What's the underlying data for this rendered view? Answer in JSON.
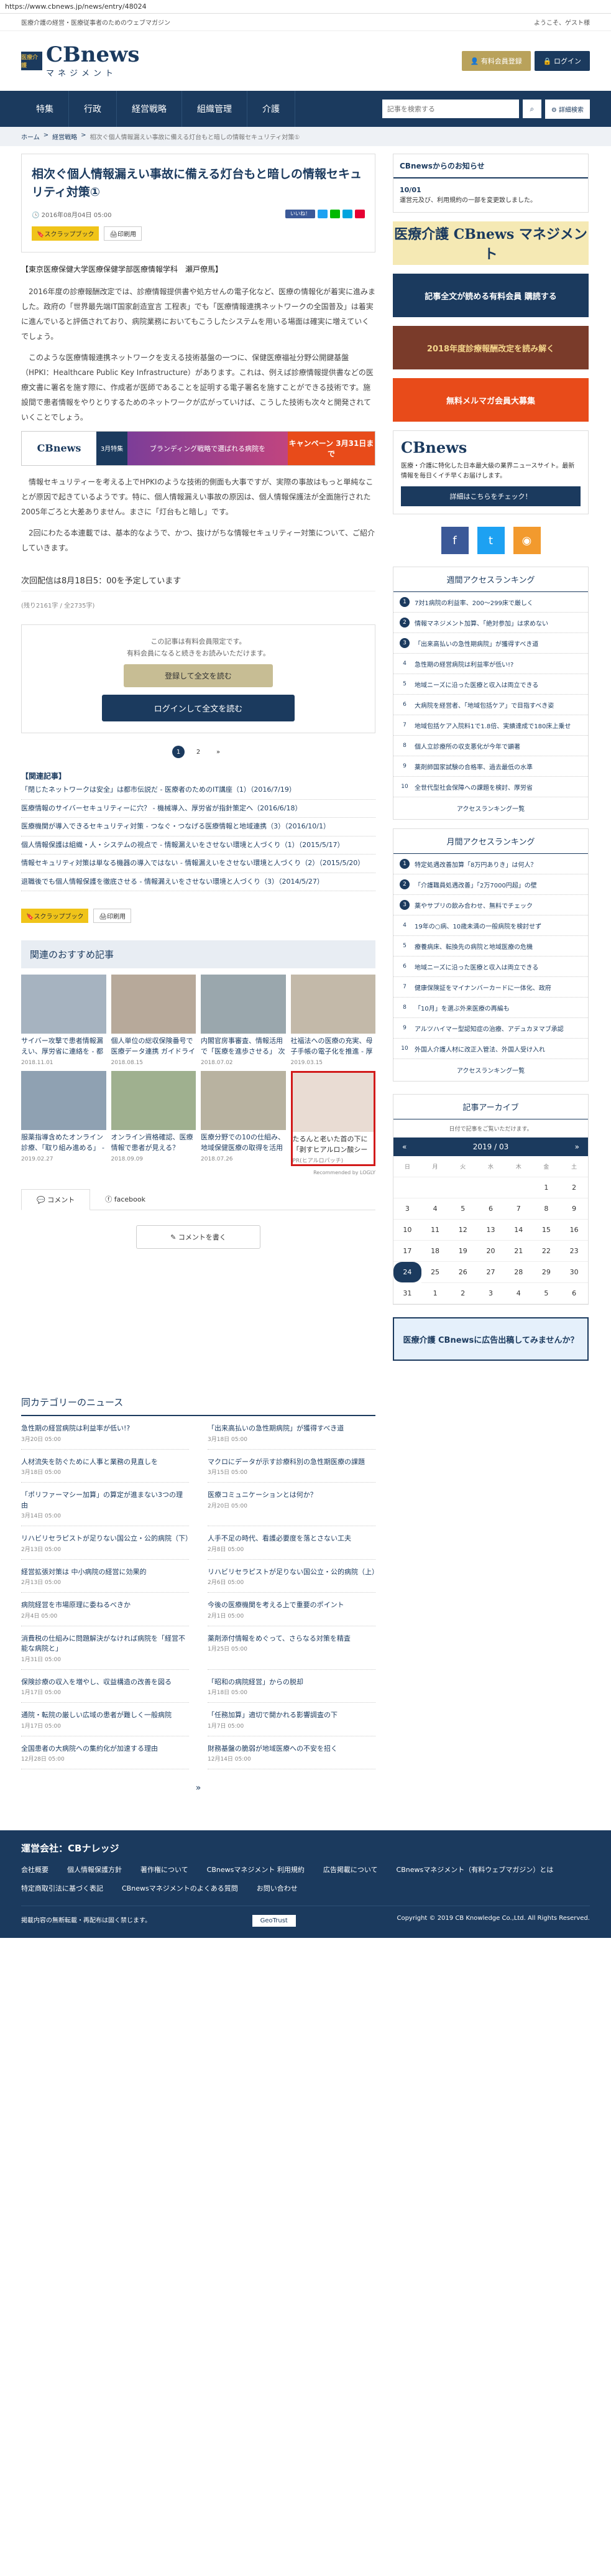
{
  "url": "https://www.cbnews.jp/news/entry/48024",
  "topbar": {
    "tagline": "医療介護の経営・医療従事者のためのウェブマガジン",
    "welcome": "ようこそ、ゲスト様"
  },
  "header": {
    "logo_mark": "医療介護",
    "logo": "CBnews",
    "logo_sub": "マネジメント",
    "register_label": "有料会員登録",
    "login_label": "ログイン"
  },
  "nav": {
    "items": [
      "特集",
      "行政",
      "経営戦略",
      "組織管理",
      "介護"
    ],
    "search_placeholder": "記事を検索する",
    "advanced_label": "詳細検索"
  },
  "breadcrumb": {
    "home": "ホーム",
    "section": "経営戦略",
    "current": "相次ぐ個人情報漏えい事故に備える灯台もと暗しの情報セキュリティ対策①"
  },
  "article": {
    "title": "相次ぐ個人情報漏えい事故に備える灯台もと暗しの情報セキュリティ対策①",
    "date": "2016年08月04日 05:00",
    "like_label": "いいね！",
    "scrap_label": "スクラップブック",
    "print_label": "印刷用",
    "author": "【東京医療保健大学医療保健学部医療情報学科　瀬戸僚馬】",
    "paragraphs": [
      "2016年度の診療報酬改定では、診療情報提供書や処方せんの電子化など、医療の情報化が着実に進みました。政府の「世界最先端IT国家創造宣言 工程表」でも「医療情報連携ネットワークの全国普及」は着実に進んでいると評価されており、病院業務においてもこうしたシステムを用いる場面は確実に増えていくでしょう。",
      "このような医療情報連携ネットワークを支える技術基盤の一つに、保健医療福祉分野公開鍵基盤（HPKI：Healthcare Public Key Infrastructure）があります。これは、例えば診療情報提供書などの医療文書に署名を施す際に、作成者が医師であることを証明する電子署名を施すことができる技術です。施設間で患者情報をやりとりするためのネットワークが広がっていけば、こうした技術も次々と開発されていくことでしょう。",
      "情報セキュリティーを考える上でHPKIのような技術的側面も大事ですが、実際の事故はもっと単純なことが原因で起きているようです。特に、個人情報漏えい事故の原因は、個人情報保護法が全面施行された2005年ごろと大差ありません。まさに「灯台もと暗し」です。",
      "2回にわたる本連載では、基本的なようで、かつ、抜けがちな情報セキュリティー対策について、ご紹介していきます。"
    ],
    "banner": {
      "b1": "CBnews",
      "b2": "3月特集",
      "b3": "ブランディング戦略で選ばれる病院を",
      "b4": "キャンペーン 3月31日まで"
    },
    "next_date": "次回配信は8月18日5：00を予定しています",
    "chars": "(残り2161字 / 全2735字)"
  },
  "paywall": {
    "line1": "この記事は有料会員限定です。",
    "line2": "有料会員になると続きをお読みいただけます。",
    "register_label": "登録して全文を読む",
    "login_label": "ログインして全文を読む"
  },
  "pager": {
    "p1": "1",
    "p2": "2",
    "next": "»"
  },
  "related": {
    "title": "【関連記事】",
    "items": [
      "「閉じたネットワークは安全」は都市伝説だ - 医療者のためのIT講座（1）（2016/7/19）",
      "医療情報のサイバーセキュリティーに穴？ - 機械導入、厚労省が指針策定へ（2016/6/18）",
      "医療機関が導入できるセキュリティ対策 - つなぐ・つなげる医療情報と地域連携（3）（2016/10/1）",
      "個人情報保護は組織・人・システムの視点で - 情報漏えいをさせない環境と人づくり（1）（2015/5/17）",
      "情報セキュリティ対策は単なる機器の導入ではない - 情報漏えいをさせない環境と人づくり（2）（2015/5/20）",
      "退職後でも個人情報保護を徹底させる - 情報漏えいをさせない環境と人づくり（3）（2014/5/27）"
    ]
  },
  "recommend": {
    "title": "関連のおすすめ記事",
    "items": [
      {
        "title": "サイバー攻撃で患者情報漏えい、厚労省に連絡を - 都道府県...",
        "date": "2018.11.01"
      },
      {
        "title": "個人単位の総収保険番号で医療データ連携 ガイドラインを...",
        "date": "2018.08.15"
      },
      {
        "title": "内閣官房事審査、情報活用で「医療を進歩させる」 次世代...",
        "date": "2018.07.02"
      },
      {
        "title": "社福法への医療の充実、母子手帳の電子化を推進 - 厚労...",
        "date": "2019.03.15"
      },
      {
        "title": "服薬指導含めたオンライン診療、「取り組み進める」 - 厚生...",
        "date": "2019.02.27"
      },
      {
        "title": "オンライン資格確認、医療情報で患者が見える？ 2020年...",
        "date": "2018.09.09"
      },
      {
        "title": "医療分野での10の仕組み、地域保健医療の取得を活用へ 厚労...",
        "date": "2018.07.26"
      },
      {
        "title": "たるんと老いた首の下に「剥すヒアルロン酸シート」",
        "date": "PR(ヒアルロパッチ)"
      }
    ],
    "credit": "Recommended by LOGLY"
  },
  "comments": {
    "tab_comment": "コメント",
    "tab_facebook": "facebook",
    "write_label": "コメントを書く"
  },
  "sidebar": {
    "notice_title": "CBnewsからのお知らせ",
    "notice_date": "10/01",
    "notice_text": "運営元及び、利用規約の一部を変更致しました。",
    "banner1": "医療介護 CBnews マネジメント",
    "banner2": "記事全文が読める有料会員 購読する",
    "banner3": "2018年度診療報酬改定を読み解く",
    "banner4": "無料メルマガ会員大募集",
    "promo_logo": "CBnews",
    "promo_text": "医療・介護に特化した日本最大級の業界ニュースサイト。最新情報を毎日くイチ早くお届けします。",
    "promo_btn": "詳細はこちらをチェック！",
    "weekly_title": "週間アクセスランキング",
    "weekly": [
      "7対1病院の利益率、200～299床で厳しく",
      "情報マネジメント加算、「絶対参加」は求めない",
      "「出来高払いの急性期病院」が獲得すべき道",
      "急性期の経営病院は利益率が低い!?",
      "地域ニーズに沿った医療と収入は両立できる",
      "大病院を経営者、「地域包括ケア」で目指すべき姿",
      "地域包括ケア入院料1で1.8倍、実績達成で180床上乗せ",
      "個人立診療所の収支悪化が今年で顕著",
      "薬剤師国家試験の合格率、過去最低の水準",
      "全世代型社会保障への課題を検討、厚労省"
    ],
    "weekly_more": "アクセスランキング一覧",
    "monthly_title": "月間アクセスランキング",
    "monthly": [
      "特定処遇改善加算「8万円ありき」は何人？",
      "「介護職員処遇改善」「2万7000円超」の壁",
      "薬やサプリの飲み合わせ、無料でチェック",
      "19年の○病、10歳未満の一般病院を検討せず",
      "療養病床、転換先の病院と地域医療の危機",
      "地域ニーズに沿った医療と収入は両立できる",
      "健康保険証をマイナンバーカードに一体化、政府",
      "「10月」を選ぶ外来医療の再編も",
      "アルツハイマー型認知症の治療、アデュカヌマブ承認",
      "外国人介護人材に改正入管法、外国人受け入れ"
    ],
    "monthly_more": "アクセスランキング一覧",
    "archive_title": "記事アーカイブ",
    "archive_sub": "日付で記事をご覧いただけます。",
    "cal_month": "2019 / 03",
    "cal_prev": "«",
    "cal_next": "»",
    "weekdays": [
      "日",
      "月",
      "火",
      "水",
      "木",
      "金",
      "土"
    ],
    "days": [
      "",
      "",
      "",
      "",
      "",
      "1",
      "2",
      "3",
      "4",
      "5",
      "6",
      "7",
      "8",
      "9",
      "10",
      "11",
      "12",
      "13",
      "14",
      "15",
      "16",
      "17",
      "18",
      "19",
      "20",
      "21",
      "22",
      "23",
      "24",
      "25",
      "26",
      "27",
      "28",
      "29",
      "30",
      "31",
      "1",
      "2",
      "3",
      "4",
      "5",
      "6"
    ],
    "banner5": "医療介護 CBnewsに広告出稿してみませんか？"
  },
  "news_section": {
    "title": "同カテゴリーのニュース",
    "items": [
      {
        "title": "急性期の経営病院は利益率が低い!?",
        "date": "3月20日 05:00"
      },
      {
        "title": "「出来高払いの急性期病院」が獲得すべき道",
        "date": "3月18日 05:00"
      },
      {
        "title": "人材流失を防ぐために人事と業務の見直しを",
        "date": "3月18日 05:00"
      },
      {
        "title": "マクロにデータが示す診療科別の急性期医療の課題",
        "date": "3月15日 05:00"
      },
      {
        "title": "「ポリファーマシー加算」の算定が進まない3つの理由",
        "date": "3月14日 05:00"
      },
      {
        "title": "医療コミュニケーションとは何か？",
        "date": "2月20日 05:00"
      },
      {
        "title": "リハビリセラピストが足りない国公立・公的病院（下）",
        "date": "2月13日 05:00"
      },
      {
        "title": "人手不足の時代、看護必要度を落とさない工夫",
        "date": "2月8日 05:00"
      },
      {
        "title": "経営拡張対策は 中小病院の経営に効果的",
        "date": "2月13日 05:00"
      },
      {
        "title": "リハビリセラピストが足りない国公立・公的病院（上）",
        "date": "2月6日 05:00"
      },
      {
        "title": "病院経営を市場原理に委ねるべきか",
        "date": "2月4日 05:00"
      },
      {
        "title": "今後の医療機関を考える上で重要のポイント",
        "date": "2月1日 05:00"
      },
      {
        "title": "消費税の仕組みに問題解決がなければ病院を「経営不能な病院と」",
        "date": "1月31日 05:00"
      },
      {
        "title": "薬剤添付情報をめぐって、さらなる対策を精査",
        "date": "1月25日 05:00"
      },
      {
        "title": "保険診療の収入を増やし、収益構造の改善を図る",
        "date": "1月17日 05:00"
      },
      {
        "title": "「昭和の病院経営」からの脱却",
        "date": "1月18日 05:00"
      },
      {
        "title": "通院・転院の厳しい広域の患者が難しく一般病院",
        "date": "1月17日 05:00"
      },
      {
        "title": "「任務加算」適切で開かれる影響調査の下",
        "date": "1月7日 05:00"
      },
      {
        "title": "全国患者の大病院への集約化が加速する理由",
        "date": "12月28日 05:00"
      },
      {
        "title": "財務基盤の脆弱が地域医療への不安を招く",
        "date": "12月14日 05:00"
      }
    ],
    "pager": "»"
  },
  "footer": {
    "title": "運営会社：CBナレッジ",
    "links": [
      "会社概要",
      "個人情報保護方針",
      "著作権について",
      "CBnewsマネジメント 利用規約",
      "広告掲載について",
      "CBnewsマネジメント（有料ウェブマガジン）とは",
      "特定商取引法に基づく表記",
      "CBnewsマネジメントのよくある質問",
      "お問い合わせ"
    ],
    "note": "掲載内容の無断転載・再配布は固く禁じます。",
    "copyright": "Copyright © 2019 CB Knowledge Co.,Ltd. All Rights Reserved.",
    "geotrust": "GeoTrust"
  }
}
